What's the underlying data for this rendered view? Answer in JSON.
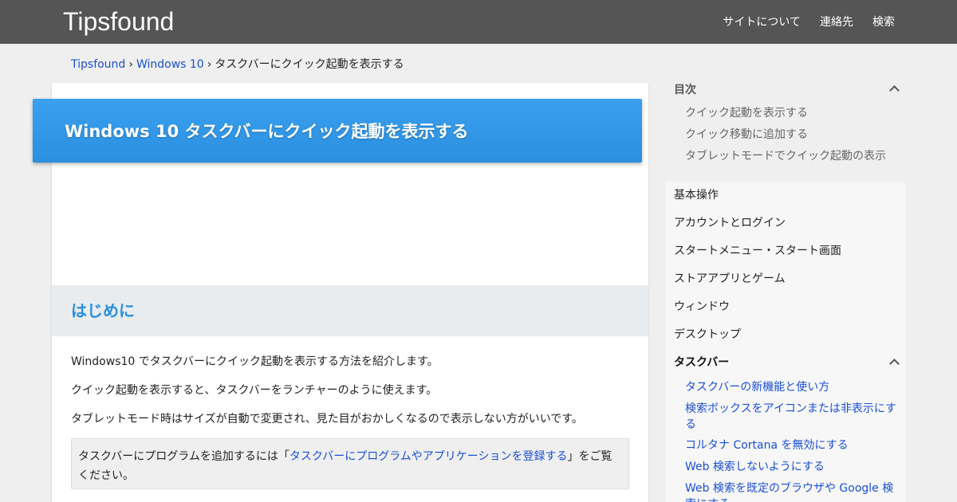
{
  "header": {
    "site_title": "Tipsfound",
    "nav": [
      "サイトについて",
      "連絡先",
      "検索"
    ]
  },
  "breadcrumb": {
    "items": [
      "Tipsfound",
      "Windows 10",
      "タスクバーにクイック起動を表示する"
    ],
    "separator": "›"
  },
  "article": {
    "title": "Windows 10 タスクバーにクイック起動を表示する",
    "section_heading": "はじめに",
    "paragraphs": [
      "Windows10 でタスクバーにクイック起動を表示する方法を紹介します。",
      "クイック起動を表示すると、タスクバーをランチャーのように使えます。",
      "タブレットモード時はサイズが自動で変更され、見た目がおかしくなるので表示しない方がいいです。"
    ],
    "note": {
      "before": "タスクバーにプログラムを追加するには「",
      "link": "タスクバーにプログラムやアプリケーションを登録する",
      "after": "」をご覧ください。"
    }
  },
  "toc": {
    "heading": "目次",
    "items": [
      "クイック起動を表示する",
      "クイック移動に追加する",
      "タブレットモードでクイック起動の表示"
    ]
  },
  "categories": {
    "items": [
      "基本操作",
      "アカウントとログイン",
      "スタートメニュー・スタート画面",
      "ストアアプリとゲーム",
      "ウィンドウ",
      "デスクトップ",
      "タスクバー"
    ],
    "active": "タスクバー",
    "sub_items": [
      "タスクバーの新機能と使い方",
      "検索ボックスをアイコンまたは非表示にする",
      "コルタナ Cortana を無効にする",
      "Web 検索しないようにする",
      "Web 検索を既定のブラウザや Google 検索にする"
    ]
  },
  "colors": {
    "header_bg": "#555555",
    "banner": "#2c8fe0",
    "link": "#1a4fd6",
    "section_heading": "#2a8ee0"
  }
}
